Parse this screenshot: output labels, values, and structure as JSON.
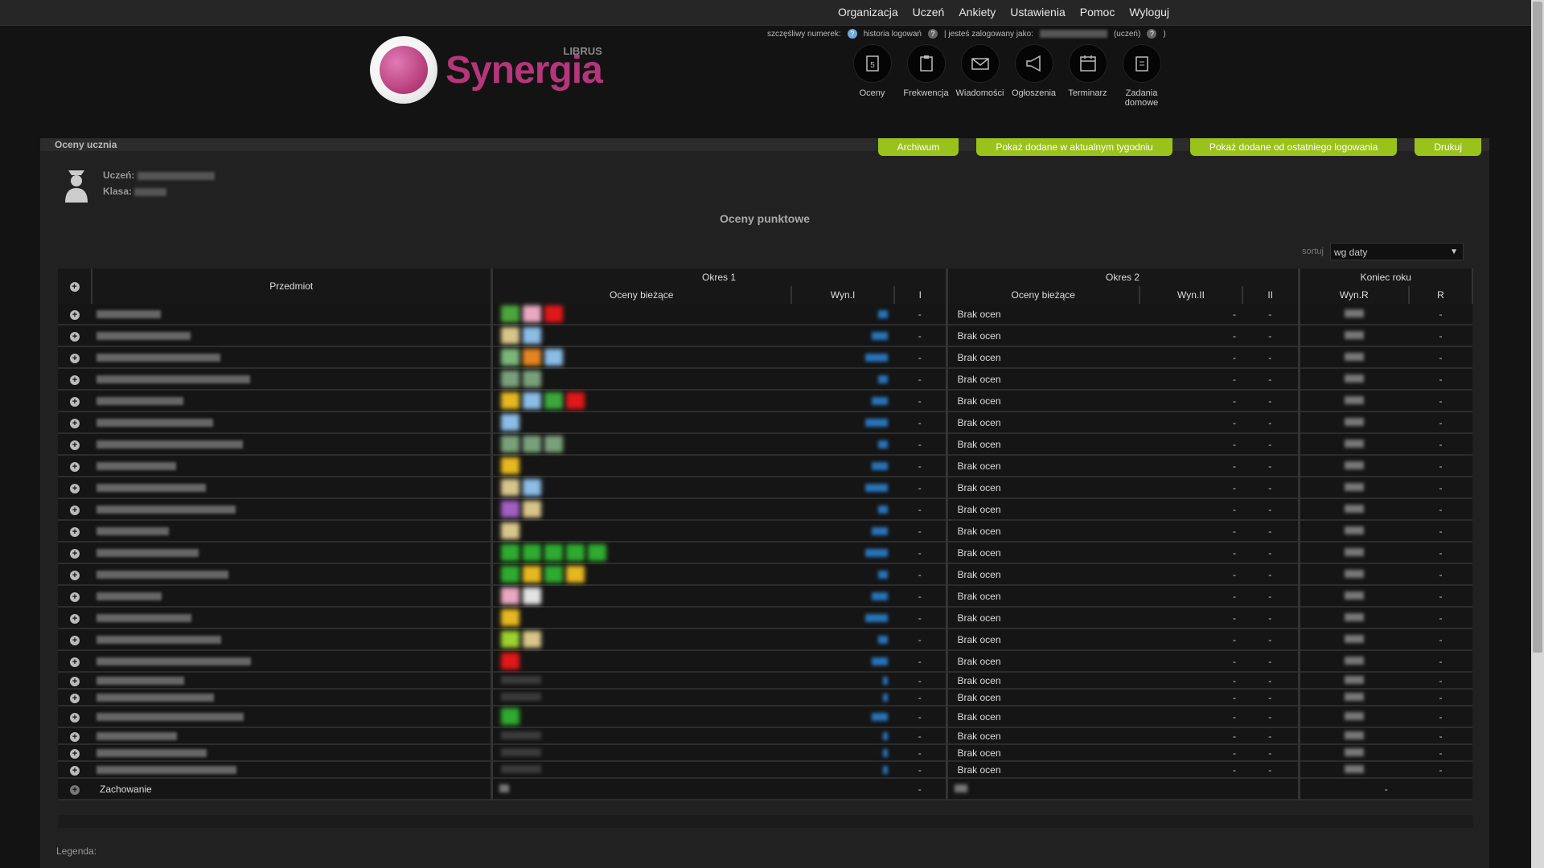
{
  "topnav": [
    "Organizacja",
    "Uczeń",
    "Ankiety",
    "Ustawienia",
    "Pomoc",
    "Wyloguj"
  ],
  "info": {
    "lucky": "szczęśliwy numerek:",
    "history": "historia logowań",
    "logged": "| jesteś zalogowany jako:",
    "role": "(uczeń)",
    "close": ")"
  },
  "logo": {
    "brand": "Synergia",
    "sub": "LIBRUS"
  },
  "icon_nav": [
    {
      "label": "Oceny",
      "icon": "grades-icon"
    },
    {
      "label": "Frekwencja",
      "icon": "attendance-icon"
    },
    {
      "label": "Wiadomości",
      "icon": "envelope-icon"
    },
    {
      "label": "Ogłoszenia",
      "icon": "megaphone-icon"
    },
    {
      "label": "Terminarz",
      "icon": "calendar-icon"
    },
    {
      "label": "Zadania domowe",
      "icon": "homework-icon"
    }
  ],
  "panel": {
    "title": "Oceny ucznia"
  },
  "tabs": [
    "Archiwum",
    "Pokaż dodane w aktualnym tygodniu",
    "Pokaż dodane od ostatniego logowania",
    "Drukuj"
  ],
  "student": {
    "name_label": "Uczeń:",
    "class_label": "Klasa:"
  },
  "page_title": "Oceny punktowe",
  "sort": {
    "label": "sortuj",
    "value": "wg daty"
  },
  "table": {
    "col_subject": "Przedmiot",
    "group1": "Okres 1",
    "group2": "Okres 2",
    "group3": "Koniec roku",
    "col_grades1": "Oceny bieżące",
    "col_wyn1": "Wyn.I",
    "col_i": "I",
    "col_grades2": "Oceny bieżące",
    "col_wyn2": "Wyn.II",
    "col_ii": "II",
    "col_wynr": "Wyn.R",
    "col_r": "R",
    "no_grades": "Brak ocen",
    "dash": "-",
    "behavior": "Zachowanie"
  },
  "rows": [
    {
      "colors": [
        "#4ca63a",
        "#e8a8c0",
        "#e01818"
      ]
    },
    {
      "colors": [
        "#d8c58a",
        "#8bbde6"
      ]
    },
    {
      "colors": [
        "#7bb77b",
        "#e58522",
        "#8bbde6"
      ]
    },
    {
      "colors": [
        "#7aa07a",
        "#7aa07a"
      ]
    },
    {
      "colors": [
        "#e6b820",
        "#8bbde6",
        "#3ca83c",
        "#e01818"
      ]
    },
    {
      "colors": [
        "#8bbde6"
      ]
    },
    {
      "colors": [
        "#7aa07a",
        "#7aa07a",
        "#7aa07a"
      ]
    },
    {
      "colors": [
        "#e6b820"
      ]
    },
    {
      "colors": [
        "#d8c58a",
        "#8bbde6"
      ]
    },
    {
      "colors": [
        "#a25ec2",
        "#d8c58a"
      ]
    },
    {
      "colors": [
        "#d8c58a"
      ]
    },
    {
      "colors": [
        "#2fab2f",
        "#2fab2f",
        "#2fab2f",
        "#2fab2f",
        "#2fab2f"
      ]
    },
    {
      "colors": [
        "#2fab2f",
        "#e6b820",
        "#2fab2f",
        "#e6b820"
      ]
    },
    {
      "colors": [
        "#e8a8c0",
        "#e2e2e2"
      ]
    },
    {
      "colors": [
        "#e6b820"
      ]
    },
    {
      "colors": [
        "#9cd12f",
        "#d8c58a"
      ]
    },
    {
      "colors": [
        "#e01818"
      ]
    },
    {
      "colors": []
    },
    {
      "colors": []
    },
    {
      "colors": [
        "#2fab2f"
      ]
    },
    {
      "colors": []
    },
    {
      "colors": []
    },
    {
      "colors": []
    }
  ],
  "legend": "Legenda:",
  "colors": {
    "accent": "#99c31a",
    "brand": "#b5367a",
    "link_blue": "#2773b8"
  }
}
